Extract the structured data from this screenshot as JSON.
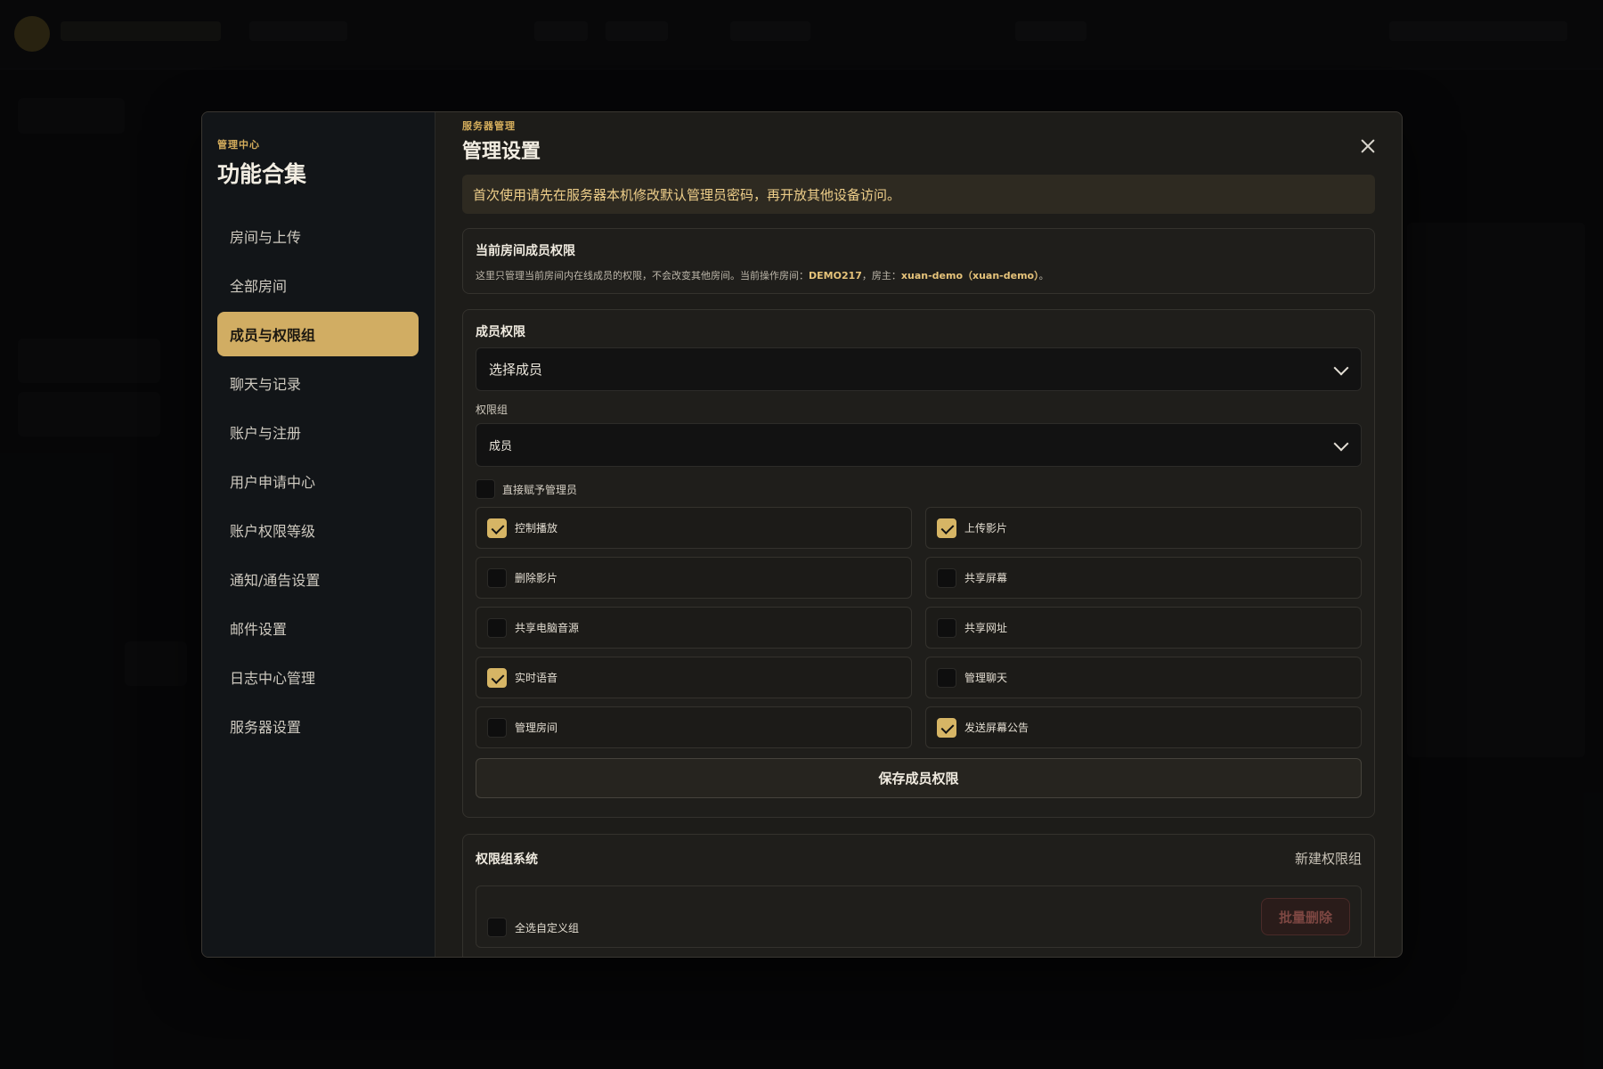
{
  "sidebar": {
    "kicker": "管理中心",
    "title": "功能合集",
    "items": [
      {
        "label": "房间与上传"
      },
      {
        "label": "全部房间"
      },
      {
        "label": "成员与权限组"
      },
      {
        "label": "聊天与记录"
      },
      {
        "label": "账户与注册"
      },
      {
        "label": "用户申请中心"
      },
      {
        "label": "账户权限等级"
      },
      {
        "label": "通知/通告设置"
      },
      {
        "label": "邮件设置"
      },
      {
        "label": "日志中心管理"
      },
      {
        "label": "服务器设置"
      }
    ],
    "active_index": 2
  },
  "main": {
    "kicker": "服务器管理",
    "title": "管理设置",
    "notice": "首次使用请先在服务器本机修改默认管理员密码，再开放其他设备访问。"
  },
  "room_card": {
    "title": "当前房间成员权限",
    "desc_prefix": "这里只管理当前房间内在线成员的权限，不会改变其他房间。当前操作房间：",
    "room_id": "DEMO217",
    "owner_prefix": "，房主：",
    "owner": "xuan-demo（xuan-demo）",
    "desc_suffix": "。"
  },
  "perm_card": {
    "title": "成员权限",
    "member_select": "选择成员",
    "group_label": "权限组",
    "group_select": "成员",
    "direct_admin": "直接赋予管理员",
    "permissions": [
      {
        "label": "控制播放",
        "checked": true
      },
      {
        "label": "上传影片",
        "checked": true
      },
      {
        "label": "删除影片",
        "checked": false
      },
      {
        "label": "共享屏幕",
        "checked": false
      },
      {
        "label": "共享电脑音源",
        "checked": false
      },
      {
        "label": "共享网址",
        "checked": false
      },
      {
        "label": "实时语音",
        "checked": true
      },
      {
        "label": "管理聊天",
        "checked": false
      },
      {
        "label": "管理房间",
        "checked": false
      },
      {
        "label": "发送屏幕公告",
        "checked": true
      }
    ],
    "save_label": "保存成员权限"
  },
  "group_card": {
    "title": "权限组系统",
    "new_group": "新建权限组",
    "select_all": "全选自定义组",
    "batch_delete": "批量删除"
  }
}
